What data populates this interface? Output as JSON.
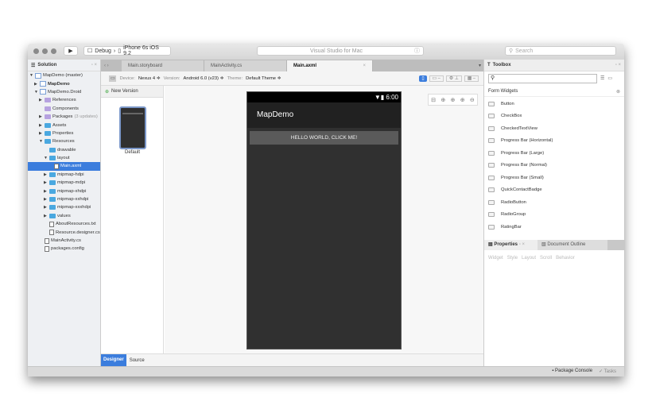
{
  "toolbar": {
    "config": "Debug",
    "device": "iPhone 6s iOS 9.2",
    "title": "Visual Studio for Mac",
    "search_placeholder": "Search"
  },
  "solution": {
    "title": "Solution",
    "items": [
      {
        "label": "MapDemo (master)",
        "level": 0,
        "arrow": "▼",
        "icon": "solution"
      },
      {
        "label": "MapDemo",
        "level": 1,
        "arrow": "▶",
        "icon": "project",
        "bold": true
      },
      {
        "label": "MapDemo.Droid",
        "level": 1,
        "arrow": "▼",
        "icon": "project"
      },
      {
        "label": "References",
        "level": 2,
        "arrow": "▶",
        "icon": "folder-purple"
      },
      {
        "label": "Components",
        "level": 2,
        "arrow": "",
        "icon": "folder-purple"
      },
      {
        "label": "Packages",
        "extra": "(3 updates)",
        "level": 2,
        "arrow": "▶",
        "icon": "folder-purple"
      },
      {
        "label": "Assets",
        "level": 2,
        "arrow": "▶",
        "icon": "folder"
      },
      {
        "label": "Properties",
        "level": 2,
        "arrow": "▶",
        "icon": "folder"
      },
      {
        "label": "Resources",
        "level": 2,
        "arrow": "▼",
        "icon": "folder"
      },
      {
        "label": "drawable",
        "level": 3,
        "arrow": "",
        "icon": "folder"
      },
      {
        "label": "layout",
        "level": 3,
        "arrow": "▼",
        "icon": "folder"
      },
      {
        "label": "Main.axml",
        "level": 4,
        "arrow": "",
        "icon": "file",
        "selected": true
      },
      {
        "label": "mipmap-hdpi",
        "level": 3,
        "arrow": "▶",
        "icon": "folder"
      },
      {
        "label": "mipmap-mdpi",
        "level": 3,
        "arrow": "▶",
        "icon": "folder"
      },
      {
        "label": "mipmap-xhdpi",
        "level": 3,
        "arrow": "▶",
        "icon": "folder"
      },
      {
        "label": "mipmap-xxhdpi",
        "level": 3,
        "arrow": "▶",
        "icon": "folder"
      },
      {
        "label": "mipmap-xxxhdpi",
        "level": 3,
        "arrow": "▶",
        "icon": "folder"
      },
      {
        "label": "values",
        "level": 3,
        "arrow": "▶",
        "icon": "folder"
      },
      {
        "label": "AboutResources.txt",
        "level": 3,
        "arrow": "",
        "icon": "file"
      },
      {
        "label": "Resource.designer.cs",
        "level": 3,
        "arrow": "",
        "icon": "file"
      },
      {
        "label": "MainActivity.cs",
        "level": 2,
        "arrow": "",
        "icon": "file"
      },
      {
        "label": "packages.config",
        "level": 2,
        "arrow": "",
        "icon": "file"
      }
    ]
  },
  "tabs": [
    {
      "label": "Main.storyboard"
    },
    {
      "label": "MainActivity.cs"
    },
    {
      "label": "Main.axml",
      "active": true
    }
  ],
  "device_bar": {
    "device_label": "Device:",
    "device": "Nexus 4 ≑",
    "version_label": "Version:",
    "version": "Android 6.0 (v23) ≑",
    "theme_label": "Theme:",
    "theme": "Default Theme ≑"
  },
  "versions": {
    "new_label": "New Version",
    "default_label": "Default"
  },
  "phone": {
    "time": "6:00",
    "app_title": "MapDemo",
    "button": "HELLO WORLD, CLICK ME!"
  },
  "bottom_tabs": {
    "designer": "Designer",
    "source": "Source"
  },
  "toolbox": {
    "title": "Toolbox",
    "section": "Form Widgets",
    "items": [
      "Button",
      "CheckBox",
      "CheckedTextView",
      "Progress Bar (Horizontal)",
      "Progress Bar (Large)",
      "Progress Bar (Normal)",
      "Progress Bar (Small)",
      "QuickContactBadge",
      "RadioButton",
      "RadioGroup",
      "RatingBar"
    ]
  },
  "properties": {
    "title": "Properties",
    "outline": "Document Outline",
    "tabs": [
      "Widget",
      "Style",
      "Layout",
      "Scroll",
      "Behavior"
    ]
  },
  "statusbar": {
    "console": "Package Console",
    "tasks": "Tasks"
  },
  "colors": {
    "accent": "#3b7ddd",
    "phone_bg": "#303030"
  }
}
